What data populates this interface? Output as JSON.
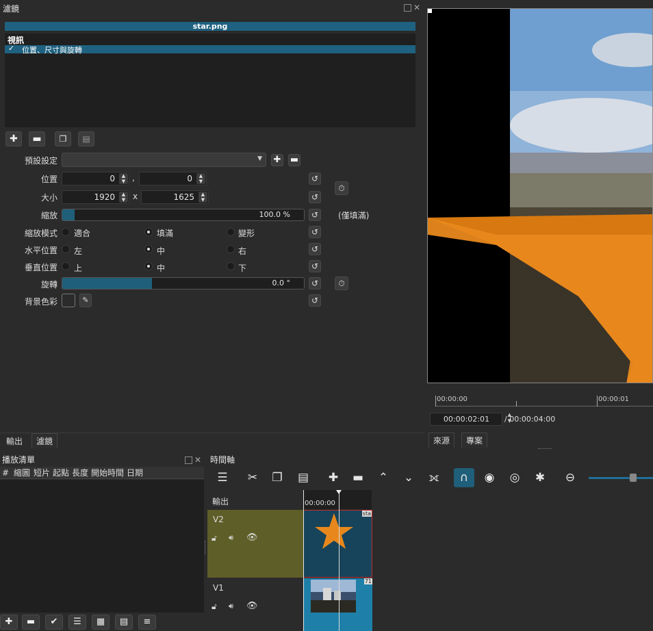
{
  "filters_panel": {
    "title": "濾鏡",
    "clip_name": "star.png",
    "section": "視訊",
    "selected_filter": "位置、尺寸與旋轉",
    "preset_label": "預設設定",
    "preset_value": "",
    "position_label": "位置",
    "position_x": "0",
    "position_sep": ",",
    "position_y": "0",
    "size_label": "大小",
    "size_w": "1920",
    "size_sep": "x",
    "size_h": "1625",
    "zoom_label": "縮放",
    "zoom_value": "100.0 %",
    "zoom_fill": 0.05,
    "zoom_note": "(僅填滿)",
    "scale_mode_label": "縮放模式",
    "scale_mode_options": [
      "適合",
      "填滿",
      "變形"
    ],
    "scale_mode_selected": 1,
    "halign_label": "水平位置",
    "halign_options": [
      "左",
      "中",
      "右"
    ],
    "halign_selected": 1,
    "valign_label": "垂直位置",
    "valign_options": [
      "上",
      "中",
      "下"
    ],
    "valign_selected": 1,
    "rotation_label": "旋轉",
    "rotation_value": "0.0 °",
    "rotation_fill": 0.37,
    "bgcolor_label": "背景色彩"
  },
  "left_tabs": [
    "輸出",
    "濾鏡"
  ],
  "player": {
    "ruler_start": "00:00:00",
    "ruler_mid": "00:00:01",
    "timecode": "00:00:02:01",
    "duration": "/ 00:00:04:00",
    "tabs": [
      "來源",
      "專案"
    ]
  },
  "playlist": {
    "title": "播放清單",
    "columns": [
      "#",
      "縮圖",
      "短片",
      "起點",
      "長度",
      "開始時間",
      "日期"
    ]
  },
  "timeline": {
    "title": "時間軸",
    "output_label": "輸出",
    "ruler_time": "00:00:00",
    "tracks": [
      {
        "name": "V2",
        "clip_label": "sta"
      },
      {
        "name": "V1",
        "clip_label": "71"
      }
    ]
  },
  "colors": {
    "accent": "#1f5f7a",
    "header_bar": "#1f6180",
    "track_v2": "#5e5e28",
    "clip_blue": "#1e7fa8",
    "star": "#e8881c"
  }
}
